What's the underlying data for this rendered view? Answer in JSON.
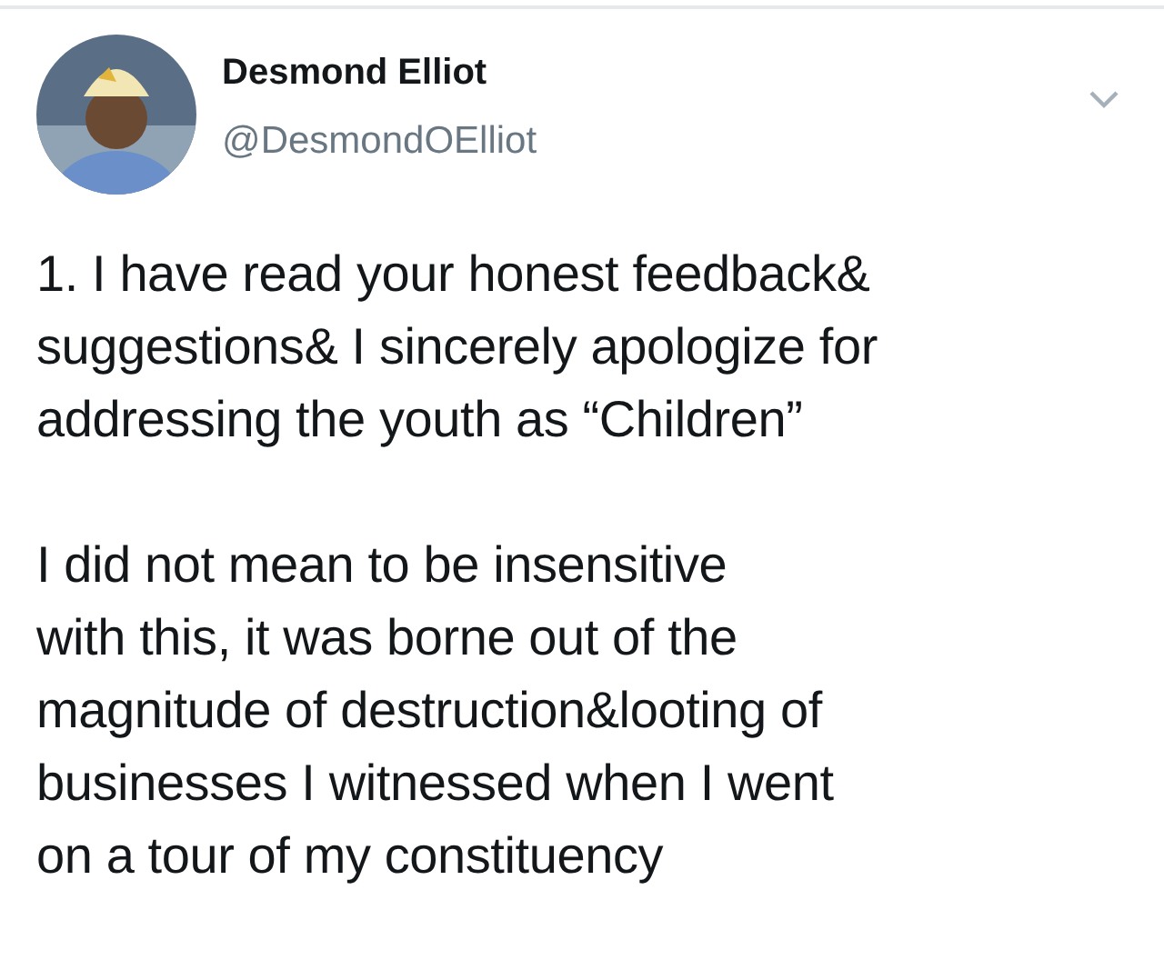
{
  "author": {
    "name": "Desmond Elliot",
    "handle": "@DesmondOElliot"
  },
  "paragraphs": [
    "1. I have read your honest feedback&\nsuggestions& I sincerely apologize for\naddressing the youth as “Children”",
    "I did not mean to be insensitive\nwith this, it was borne out of the\nmagnitude of destruction&looting of\nbusinesses I witnessed when I went\non a tour of my constituency"
  ]
}
